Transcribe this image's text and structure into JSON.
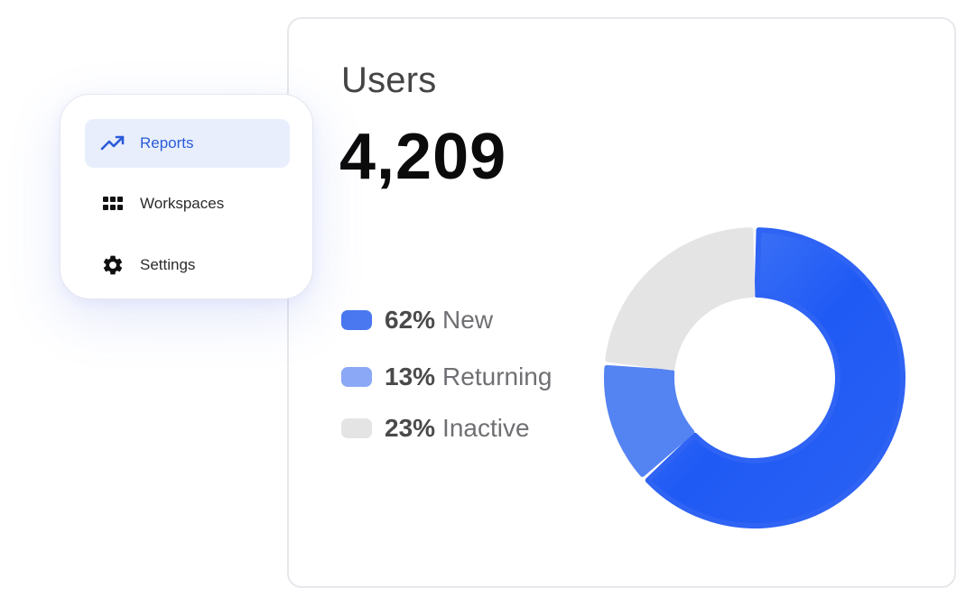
{
  "nav": {
    "items": [
      {
        "label": "Reports",
        "icon": "trending-up-icon",
        "active": true
      },
      {
        "label": "Workspaces",
        "icon": "grid-icon",
        "active": false
      },
      {
        "label": "Settings",
        "icon": "gear-icon",
        "active": false
      }
    ]
  },
  "card": {
    "title": "Users",
    "value": "4,209"
  },
  "legend": [
    {
      "pct": "62%",
      "label": "New",
      "color": "#4a78f0"
    },
    {
      "pct": "13%",
      "label": "Returning",
      "color": "#8aa8f6"
    },
    {
      "pct": "23%",
      "label": "Inactive",
      "color": "#e4e4e4"
    }
  ],
  "chart_data": {
    "type": "pie",
    "categories": [
      "New",
      "Returning",
      "Inactive"
    ],
    "values": [
      62,
      13,
      23
    ],
    "colors": [
      "#2e63f4",
      "#5483f2",
      "#e4e4e4"
    ]
  },
  "colors": {
    "accent": "#2a5bd8",
    "active_bg": "#e8eefc"
  }
}
